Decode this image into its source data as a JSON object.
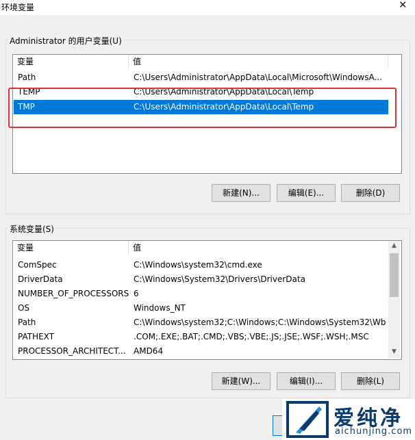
{
  "window": {
    "title": "环境变量",
    "close_glyph": "✕"
  },
  "user_vars": {
    "group_label": "Administrator 的用户变量(U)",
    "columns": [
      "变量",
      "值"
    ],
    "rows": [
      {
        "name": "Path",
        "value": "C:\\Users\\Administrator\\AppData\\Local\\Microsoft\\WindowsA...",
        "selected": false
      },
      {
        "name": "TEMP",
        "value": "C:\\Users\\Administrator\\AppData\\Local\\Temp",
        "selected": false
      },
      {
        "name": "TMP",
        "value": "C:\\Users\\Administrator\\AppData\\Local\\Temp",
        "selected": true
      }
    ],
    "buttons": {
      "new": "新建(N)...",
      "edit": "编辑(E)...",
      "delete": "删除(D)"
    }
  },
  "system_vars": {
    "group_label": "系统变量(S)",
    "columns": [
      "变量",
      "值"
    ],
    "rows": [
      {
        "name": "ComSpec",
        "value": "C:\\Windows\\system32\\cmd.exe"
      },
      {
        "name": "DriverData",
        "value": "C:\\Windows\\System32\\Drivers\\DriverData"
      },
      {
        "name": "NUMBER_OF_PROCESSORS",
        "value": "6"
      },
      {
        "name": "OS",
        "value": "Windows_NT"
      },
      {
        "name": "Path",
        "value": "C:\\Windows\\system32;C:\\Windows;C:\\Windows\\System32\\Wb..."
      },
      {
        "name": "PATHEXT",
        "value": ".COM;.EXE;.BAT;.CMD;.VBS;.VBE;.JS;.JSE;.WSF;.WSH;.MSC"
      },
      {
        "name": "PROCESSOR_ARCHITECT...",
        "value": "AMD64"
      }
    ],
    "buttons": {
      "new": "新建(W)...",
      "edit": "编辑(I)...",
      "delete": "删除(L)"
    }
  },
  "watermark": {
    "text": "爱纯净",
    "url": "aichunjing.com"
  },
  "colors": {
    "selection": "#0078d7",
    "highlight_box": "#e0303a",
    "logo": "#0b3a6b"
  }
}
